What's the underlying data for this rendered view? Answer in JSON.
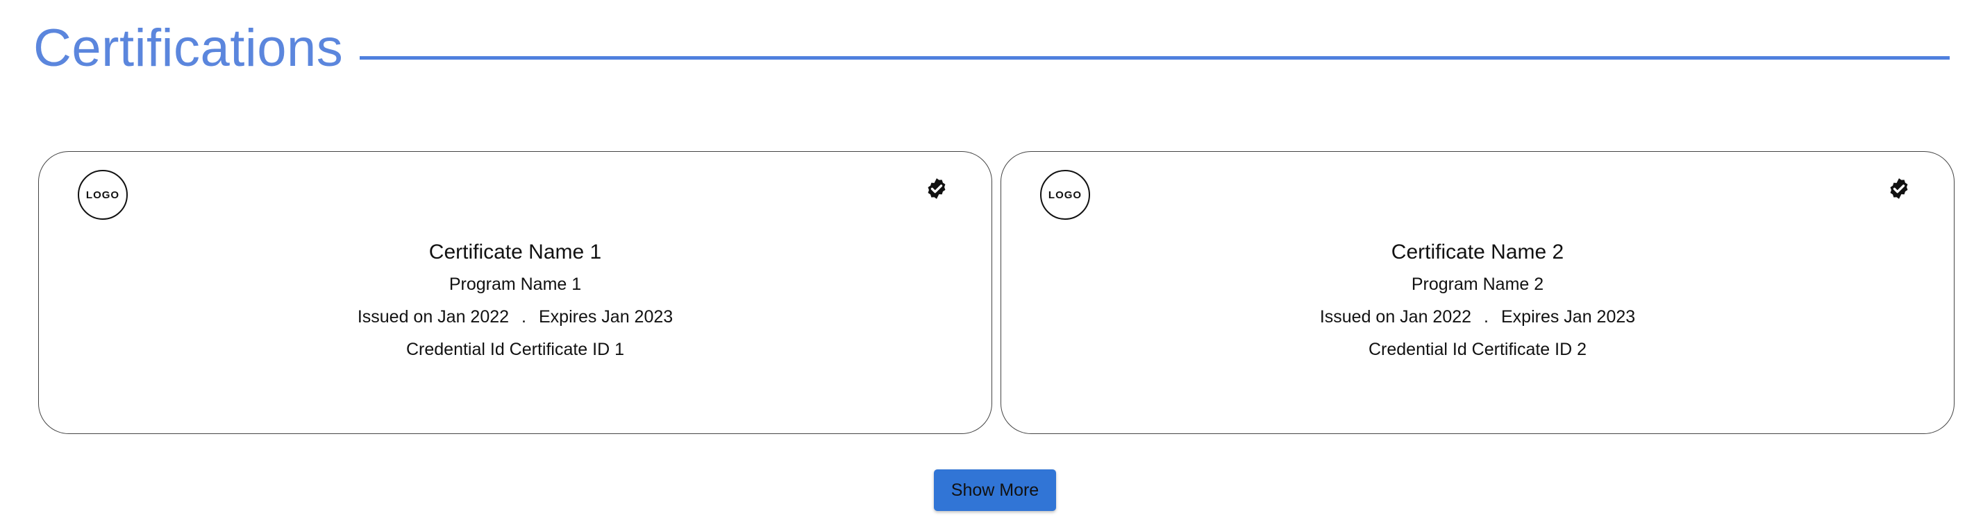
{
  "section": {
    "title": "Certifications",
    "accent_color": "#5b86dd"
  },
  "certifications": [
    {
      "logo_text": "LOGO",
      "verified_icon": "verified-badge-icon",
      "name": "Certificate Name 1",
      "program": "Program Name 1",
      "issued": "Issued on Jan 2022",
      "separator": ".",
      "expires": "Expires Jan 2023",
      "credential": "Credential Id Certificate ID 1"
    },
    {
      "logo_text": "LOGO",
      "verified_icon": "verified-badge-icon",
      "name": "Certificate Name 2",
      "program": "Program Name 2",
      "issued": "Issued on Jan 2022",
      "separator": ".",
      "expires": "Expires Jan 2023",
      "credential": "Credential Id Certificate ID 2"
    }
  ],
  "actions": {
    "show_more_label": "Show More",
    "button_color": "#3175d6"
  }
}
